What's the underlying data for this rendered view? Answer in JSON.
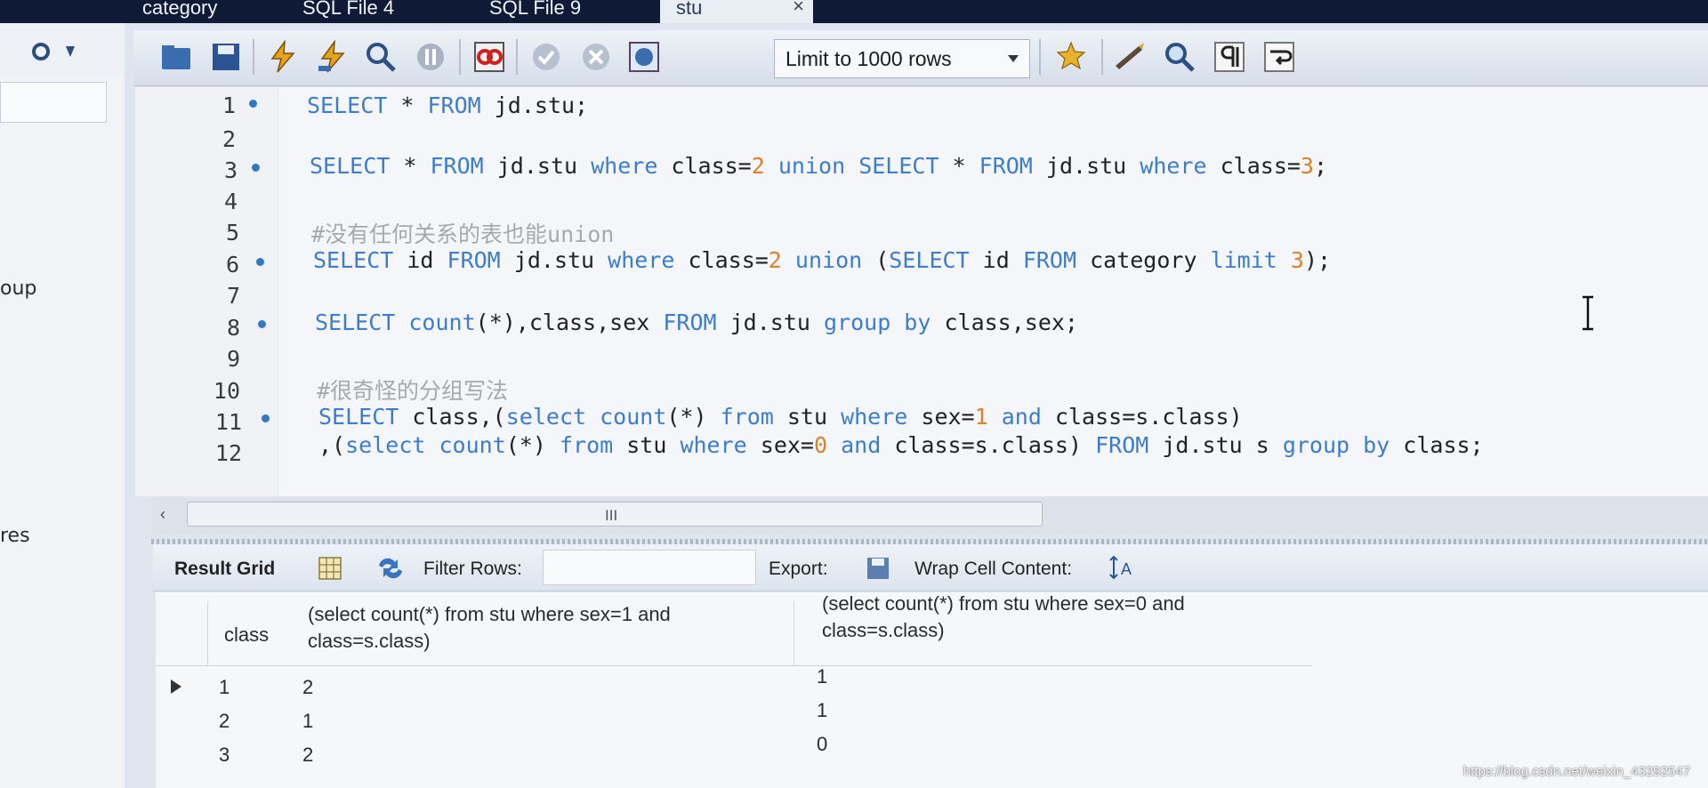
{
  "tabs": [
    {
      "label": "category"
    },
    {
      "label": "SQL File 4"
    },
    {
      "label": "SQL File 9"
    },
    {
      "label": "stu",
      "active": true
    }
  ],
  "tab_close": "×",
  "left_panel": {
    "labels": [
      "oup",
      "res"
    ]
  },
  "toolbar": {
    "limit_select": "Limit to 1000 rows",
    "icons": [
      "open-folder-icon",
      "save-icon",
      "execute-icon",
      "execute-current-icon",
      "explain-icon",
      "stop-icon",
      "toggle-results-icon",
      "commit-icon",
      "rollback-icon",
      "autocommit-icon",
      "bookmark-icon",
      "beautify-icon",
      "find-icon",
      "invisible-chars-icon",
      "wrap-icon"
    ]
  },
  "editor": {
    "lines": [
      {
        "n": "1",
        "dot": true
      },
      {
        "n": "2",
        "dot": false
      },
      {
        "n": "3",
        "dot": true
      },
      {
        "n": "4",
        "dot": false
      },
      {
        "n": "5",
        "dot": false
      },
      {
        "n": "6",
        "dot": true
      },
      {
        "n": "7",
        "dot": false
      },
      {
        "n": "8",
        "dot": true
      },
      {
        "n": "9",
        "dot": false
      },
      {
        "n": "10",
        "dot": false
      },
      {
        "n": "11",
        "dot": true
      },
      {
        "n": "12",
        "dot": false
      }
    ],
    "code": {
      "l1": [
        "SELECT",
        " * ",
        "FROM",
        " jd.stu;"
      ],
      "l3": [
        "SELECT",
        " * ",
        "FROM",
        " jd.stu ",
        "where",
        " class=",
        "2",
        " ",
        "union",
        " ",
        "SELECT",
        " * ",
        "FROM",
        " jd.stu ",
        "where",
        " class=",
        "3",
        ";"
      ],
      "l5": "#没有任何关系的表也能union",
      "l6": [
        "SELECT",
        " id ",
        "FROM",
        " jd.stu ",
        "where",
        " class=",
        "2",
        " ",
        "union",
        " (",
        "SELECT",
        " id ",
        "FROM",
        " category ",
        "limit",
        " ",
        "3",
        ");"
      ],
      "l8": [
        "SELECT",
        " ",
        "count",
        "(*),class,sex ",
        "FROM",
        " jd.stu ",
        "group by",
        " class,sex;"
      ],
      "l10": "#很奇怪的分组写法",
      "l11": [
        "SELECT",
        " class,(",
        "select",
        " ",
        "count",
        "(*) ",
        "from",
        " stu ",
        "where",
        " sex=",
        "1",
        " ",
        "and",
        " class=s.class)"
      ],
      "l12": [
        ",(",
        "select",
        " ",
        "count",
        "(*) ",
        "from",
        " stu ",
        "where",
        " sex=",
        "0",
        " ",
        "and",
        " class=s.class) ",
        "FROM",
        " jd.stu s ",
        "group by",
        " class;"
      ]
    }
  },
  "hscroll": {
    "grip": "III",
    "left_arrow": "‹"
  },
  "result_bar": {
    "result_grid": "Result Grid",
    "filter_rows": "Filter Rows:",
    "export": "Export:",
    "wrap_cell": "Wrap Cell Content:"
  },
  "grid": {
    "headers": [
      "class",
      "(select count(*) from stu where sex=1 and class=s.class)",
      "(select count(*) from stu where sex=0 and class=s.class)"
    ],
    "header_lines": {
      "h2a": "(select count(*) from stu where sex=1 and",
      "h2b": "class=s.class)",
      "h3a": "(select count(*) from stu where sex=0 and",
      "h3b": "class=s.class)"
    },
    "rows": [
      [
        "1",
        "2",
        "1"
      ],
      [
        "2",
        "1",
        "1"
      ],
      [
        "3",
        "2",
        "0"
      ]
    ]
  },
  "watermark": "https://blog.csdn.net/weixin_43292547"
}
